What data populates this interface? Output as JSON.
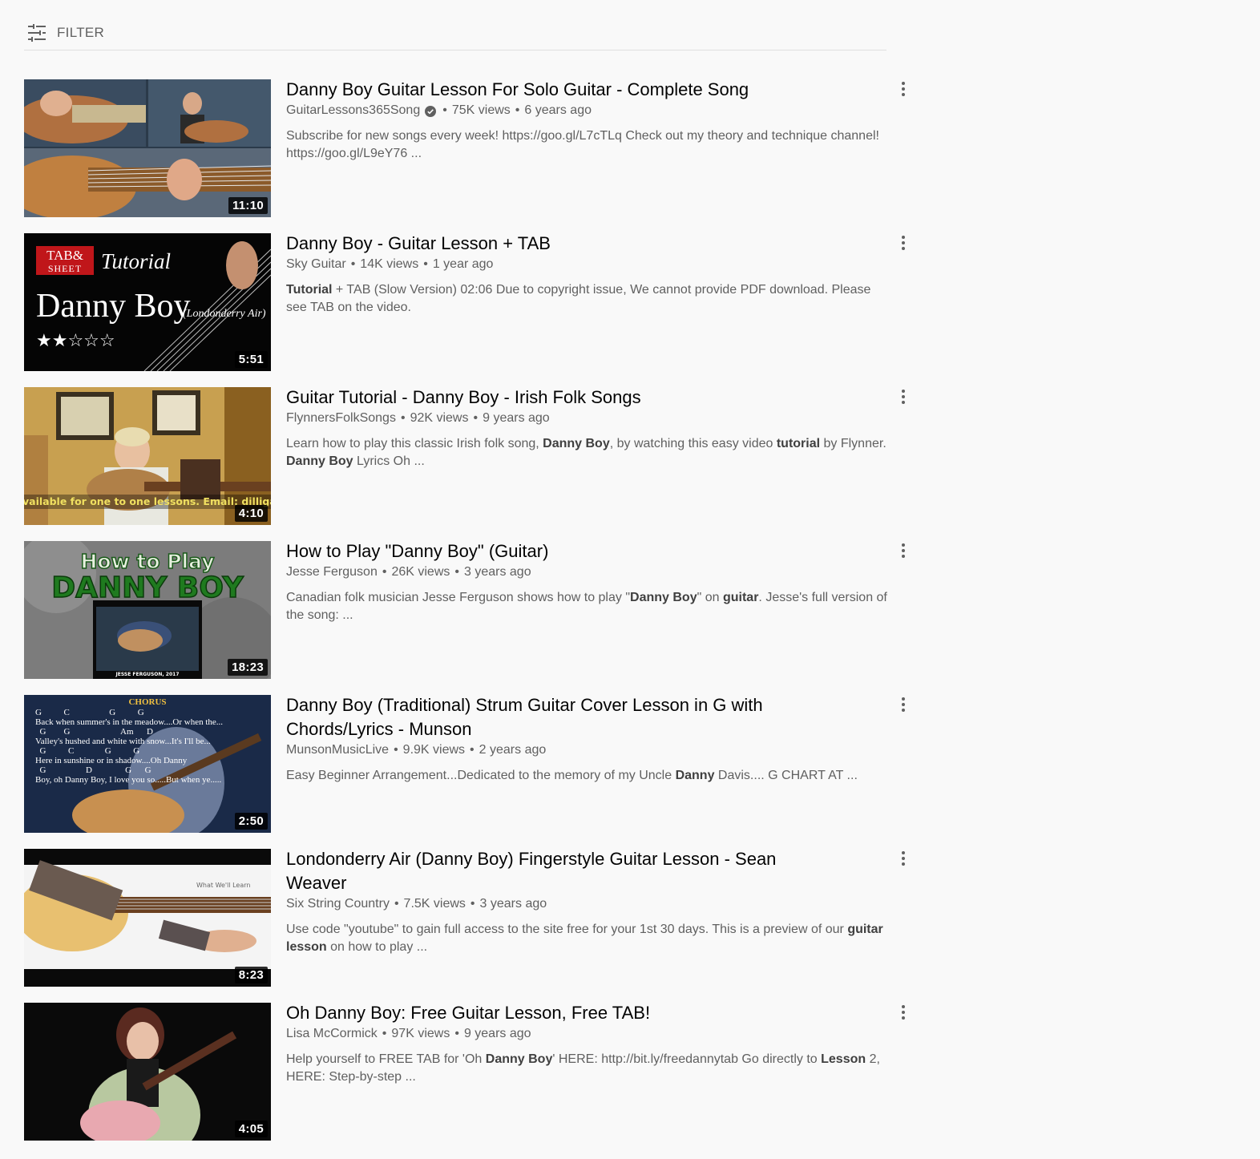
{
  "filter": {
    "label": "FILTER",
    "icon": "filter-sliders-icon"
  },
  "videos": [
    {
      "title": "Danny Boy Guitar Lesson For Solo Guitar - Complete Song",
      "channel": "GuitarLessons365Song",
      "verified": true,
      "views": "75K views",
      "age": "6 years ago",
      "duration": "11:10",
      "desc": [
        {
          "t": "Subscribe for new songs every week! https://goo.gl/L7cTLq Check out my theory and technique channel! https://goo.gl/L9eY76 ..."
        }
      ]
    },
    {
      "title": "Danny Boy - Guitar Lesson + TAB",
      "channel": "Sky Guitar",
      "verified": false,
      "views": "14K views",
      "age": "1 year ago",
      "duration": "5:51",
      "thumb_text": {
        "badge1": "TAB&",
        "badge2": "SHEET",
        "tutorial": "Tutorial",
        "name": "Danny Boy",
        "sub": "(Londonderry Air)",
        "stars": "★★☆☆☆"
      },
      "desc": [
        {
          "t": "Tutorial",
          "b": true
        },
        {
          "t": " + TAB (Slow Version) 02:06 Due to copyright issue, We cannot provide PDF download. Please see TAB on the video."
        }
      ]
    },
    {
      "title": "Guitar Tutorial - Danny Boy - Irish Folk Songs",
      "channel": "FlynnersFolkSongs",
      "verified": false,
      "views": "92K views",
      "age": "9 years ago",
      "duration": "4:10",
      "thumb_text": {
        "caption": "vailable for one to one lessons. Email: dilligaf"
      },
      "desc": [
        {
          "t": "Learn how to play this classic Irish folk song, "
        },
        {
          "t": "Danny Boy",
          "b": true
        },
        {
          "t": ", by watching this easy video "
        },
        {
          "t": "tutorial",
          "b": true
        },
        {
          "t": " by Flynner. "
        },
        {
          "t": "Danny Boy",
          "b": true
        },
        {
          "t": " Lyrics Oh ..."
        }
      ]
    },
    {
      "title": "How to Play \"Danny Boy\" (Guitar)",
      "channel": "Jesse Ferguson",
      "verified": false,
      "views": "26K views",
      "age": "3 years ago",
      "duration": "18:23",
      "thumb_text": {
        "line1": "How to Play",
        "line2": "DANNY BOY",
        "credit": "JESSE FERGUSON, 2017"
      },
      "desc": [
        {
          "t": "Canadian folk musician Jesse Ferguson shows how to play \""
        },
        {
          "t": "Danny Boy",
          "b": true
        },
        {
          "t": "\" on "
        },
        {
          "t": "guitar",
          "b": true
        },
        {
          "t": ". Jesse's full version of the song: ..."
        }
      ]
    },
    {
      "title": "Danny Boy (Traditional) Strum Guitar Cover Lesson in G with Chords/Lyrics - Munson",
      "channel": "MunsonMusicLive",
      "verified": false,
      "views": "9.9K views",
      "age": "2 years ago",
      "duration": "2:50",
      "thumb_text": {
        "chorus": "CHORUS",
        "lines": [
          "G          C                  G          G",
          "Back when summer's in the meadow....Or when the...",
          "  G        G                       Am      D",
          "Valley's hushed and white with snow...It's I'll be...",
          "  G          C              G          G",
          "Here in sunshine or in shadow....Oh Danny",
          "  G                  D               G      G",
          "Boy, oh Danny Boy, I love you so.....But when ye....."
        ]
      },
      "desc": [
        {
          "t": "Easy Beginner Arrangement...Dedicated to the memory of my Uncle "
        },
        {
          "t": "Danny",
          "b": true
        },
        {
          "t": " Davis.... G CHART AT ..."
        }
      ]
    },
    {
      "title": "Londonderry Air (Danny Boy) Fingerstyle Guitar Lesson - Sean Weaver",
      "channel": "Six String Country",
      "verified": false,
      "views": "7.5K views",
      "age": "3 years ago",
      "duration": "8:23",
      "thumb_text": {
        "label": "What We'll Learn"
      },
      "desc": [
        {
          "t": "Use code \"youtube\" to gain full access to the site free for your 1st 30 days. This is a preview of our "
        },
        {
          "t": "guitar lesson",
          "b": true
        },
        {
          "t": " on how to play ..."
        }
      ]
    },
    {
      "title": "Oh Danny Boy: Free Guitar Lesson, Free TAB!",
      "channel": "Lisa McCormick",
      "verified": false,
      "views": "97K views",
      "age": "9 years ago",
      "duration": "4:05",
      "desc": [
        {
          "t": "Help yourself to FREE TAB for 'Oh "
        },
        {
          "t": "Danny Boy",
          "b": true
        },
        {
          "t": "' HERE: http://bit.ly/freedannytab Go directly to "
        },
        {
          "t": "Lesson",
          "b": true
        },
        {
          "t": " 2, HERE: Step-by-step ..."
        }
      ]
    }
  ],
  "colors": {
    "background": "#f9f9f9",
    "title": "#030303",
    "meta": "#606060",
    "divider": "#e0e0e0"
  }
}
